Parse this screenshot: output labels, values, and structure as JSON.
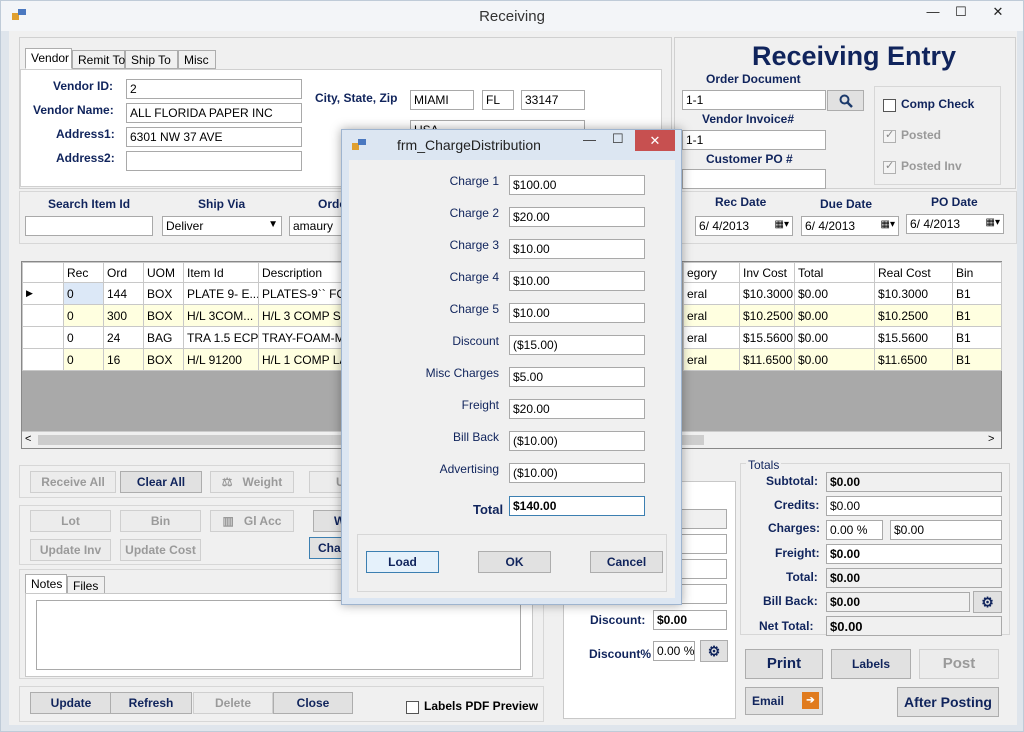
{
  "window": {
    "title": "Receiving",
    "min": "—",
    "max": "☐",
    "close": "✕"
  },
  "header": {
    "title": "Receiving Entry"
  },
  "vendor_tabs": [
    "Vendor",
    "Remit To",
    "Ship To",
    "Misc"
  ],
  "vendor": {
    "id_label": "Vendor ID:",
    "id": "2",
    "name_label": "Vendor Name:",
    "name": "ALL FLORIDA PAPER INC",
    "addr1_label": "Address1:",
    "addr1": "6301 NW 37 AVE",
    "addr2_label": "Address2:",
    "addr2": "",
    "csz_label": "City, State, Zip",
    "city": "MIAMI",
    "state": "FL",
    "zip": "33147",
    "country": "USA"
  },
  "order": {
    "order_doc_label": "Order Document",
    "order_doc": "1-1",
    "vendor_invoice_label": "Vendor Invoice#",
    "vendor_invoice": "1-1",
    "customer_po_label": "Customer PO #",
    "customer_po": ""
  },
  "checks": {
    "comp_check": "Comp Check",
    "posted": "Posted",
    "posted_inv": "Posted Inv"
  },
  "search": {
    "item_label": "Search Item Id",
    "item": "",
    "shipvia_label": "Ship Via",
    "shipvia": "Deliver",
    "order_label": "Orde",
    "order": "amaury",
    "rec_date_label": "Rec Date",
    "rec_date": "6/ 4/2013",
    "due_date_label": "Due Date",
    "due_date": "6/ 4/2013",
    "po_date_label": "PO Date",
    "po_date": "6/ 4/2013"
  },
  "grid": {
    "left_headers": [
      "",
      "Rec",
      "Ord",
      "UOM",
      "Item Id",
      "Description"
    ],
    "right_headers": [
      "egory",
      "Inv Cost",
      "Total",
      "Real Cost",
      "Bin"
    ],
    "rows": [
      {
        "marker": "▶",
        "rec": "0",
        "ord": "144",
        "uom": "BOX",
        "item": "PLATE 9- E...",
        "desc": "PLATES-9`` FOA",
        "cat": "eral",
        "inv": "$10.3000",
        "total": "$0.00",
        "real": "$10.3000",
        "bin": "B1"
      },
      {
        "marker": "",
        "rec": "0",
        "ord": "300",
        "uom": "BOX",
        "item": "H/L 3COM...",
        "desc": "H/L 3 COMP SM",
        "cat": "eral",
        "inv": "$10.2500",
        "total": "$0.00",
        "real": "$10.2500",
        "bin": "B1"
      },
      {
        "marker": "",
        "rec": "0",
        "ord": "24",
        "uom": "BAG",
        "item": "TRA 1.5 ECP",
        "desc": "TRAY-FOAM-ME",
        "cat": "eral",
        "inv": "$15.5600",
        "total": "$0.00",
        "real": "$15.5600",
        "bin": "B1"
      },
      {
        "marker": "",
        "rec": "0",
        "ord": "16",
        "uom": "BOX",
        "item": "H/L 91200",
        "desc": "H/L 1 COMP LA",
        "cat": "eral",
        "inv": "$11.6500",
        "total": "$0.00",
        "real": "$11.6500",
        "bin": "B1"
      }
    ]
  },
  "buttons": {
    "receive_all": "Receive All",
    "clear_all": "Clear All",
    "weight": "Weight",
    "u": "U",
    "lot": "Lot",
    "bin": "Bin",
    "gl_acc": "Gl Acc",
    "wh": "Wh",
    "update_inv": "Update Inv",
    "update_cost": "Update Cost",
    "char": "Char",
    "update": "Update",
    "refresh": "Refresh",
    "delete": "Delete",
    "close": "Close",
    "labels_pdf": "Labels PDF Preview",
    "print": "Print",
    "labels": "Labels",
    "post": "Post",
    "email": "Email",
    "after_posting": "After Posting"
  },
  "notes_tabs": [
    "Notes",
    "Files"
  ],
  "discount": {
    "discount_label": "Discount:",
    "discount": "$0.00",
    "discount_pct_label": "Discount%",
    "discount_pct": "0.00 %"
  },
  "totals": {
    "group_label": "Totals",
    "subtotal_label": "Subtotal:",
    "subtotal": "$0.00",
    "credits_label": "Credits:",
    "credits": "$0.00",
    "charges_label": "Charges:",
    "charges_pct": "0.00 %",
    "charges": "$0.00",
    "freight_label": "Freight:",
    "freight": "$0.00",
    "total_label": "Total:",
    "total": "$0.00",
    "billback_label": "Bill Back:",
    "billback": "$0.00",
    "nettotal_label": "Net Total:",
    "nettotal": "$0.00"
  },
  "dialog": {
    "title": "frm_ChargeDistribution",
    "rows": [
      {
        "label": "Charge 1",
        "value": "$100.00"
      },
      {
        "label": "Charge 2",
        "value": "$20.00"
      },
      {
        "label": "Charge 3",
        "value": "$10.00"
      },
      {
        "label": "Charge 4",
        "value": "$10.00"
      },
      {
        "label": "Charge 5",
        "value": "$10.00"
      },
      {
        "label": "Discount",
        "value": "($15.00)"
      },
      {
        "label": "Misc Charges",
        "value": "$5.00"
      },
      {
        "label": "Freight",
        "value": "$20.00"
      },
      {
        "label": "Bill Back",
        "value": "($10.00)"
      },
      {
        "label": "Advertising",
        "value": "($10.00)"
      }
    ],
    "total_label": "Total",
    "total": "$140.00",
    "load": "Load",
    "ok": "OK",
    "cancel": "Cancel"
  },
  "colors": {
    "label": "#10245c",
    "row_yellow": "#ffffe0",
    "grid_empty": "#a9a9a9",
    "selected_cell": "#dce8f7"
  }
}
